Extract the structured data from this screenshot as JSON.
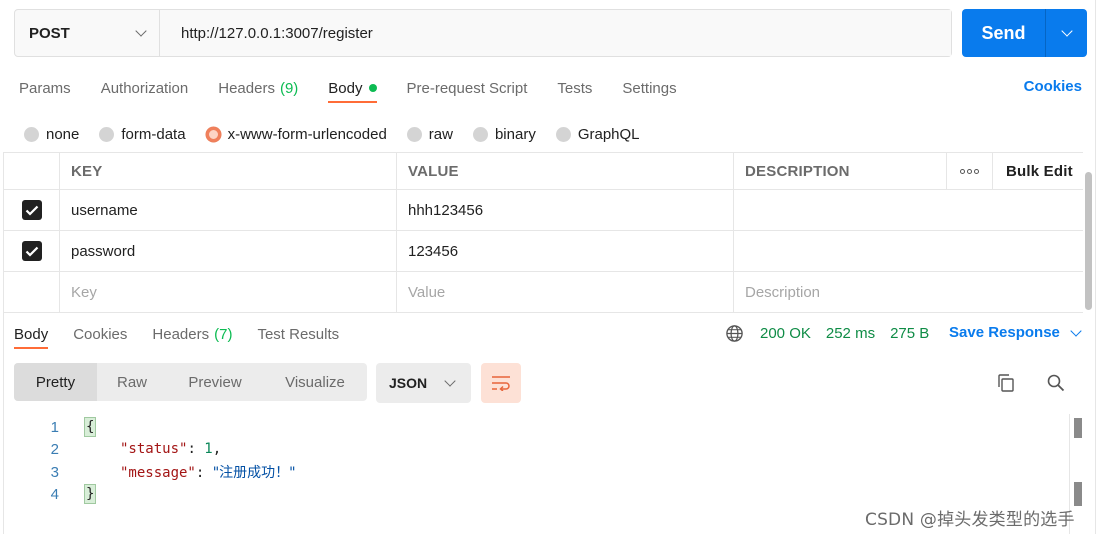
{
  "request": {
    "method": "POST",
    "url": "http://127.0.0.1:3007/register",
    "send_label": "Send"
  },
  "request_tabs": [
    {
      "label": "Params",
      "count": "",
      "active": false
    },
    {
      "label": "Authorization",
      "count": "",
      "active": false
    },
    {
      "label": "Headers",
      "count": "(9)",
      "active": false
    },
    {
      "label": "Body",
      "count": "",
      "active": true
    },
    {
      "label": "Pre-request Script",
      "count": "",
      "active": false
    },
    {
      "label": "Tests",
      "count": "",
      "active": false
    },
    {
      "label": "Settings",
      "count": "",
      "active": false
    }
  ],
  "cookies_label": "Cookies",
  "body_types": [
    {
      "label": "none",
      "selected": false
    },
    {
      "label": "form-data",
      "selected": false
    },
    {
      "label": "x-www-form-urlencoded",
      "selected": true
    },
    {
      "label": "raw",
      "selected": false
    },
    {
      "label": "binary",
      "selected": false
    },
    {
      "label": "GraphQL",
      "selected": false
    }
  ],
  "params_table": {
    "headers": {
      "key": "KEY",
      "value": "VALUE",
      "description": "DESCRIPTION",
      "bulk_edit": "Bulk Edit"
    },
    "rows": [
      {
        "checked": true,
        "key": "username",
        "value": "hhh123456",
        "description": ""
      },
      {
        "checked": true,
        "key": "password",
        "value": "123456",
        "description": ""
      }
    ],
    "placeholder": {
      "key": "Key",
      "value": "Value",
      "description": "Description"
    }
  },
  "response_tabs": [
    {
      "label": "Body",
      "count": "",
      "active": true
    },
    {
      "label": "Cookies",
      "count": "",
      "active": false
    },
    {
      "label": "Headers",
      "count": "(7)",
      "active": false
    },
    {
      "label": "Test Results",
      "count": "",
      "active": false
    }
  ],
  "response_meta": {
    "status": "200 OK",
    "time": "252 ms",
    "size": "275 B",
    "save_label": "Save Response"
  },
  "view_modes": [
    {
      "label": "Pretty",
      "active": true
    },
    {
      "label": "Raw",
      "active": false
    },
    {
      "label": "Preview",
      "active": false
    },
    {
      "label": "Visualize",
      "active": false
    }
  ],
  "format": "JSON",
  "code_lines": {
    "n1": "1",
    "n2": "2",
    "n3": "3",
    "n4": "4",
    "open": "{",
    "close": "}",
    "status_key": "\"status\"",
    "status_val": "1",
    "message_key": "\"message\"",
    "message_val": "\"注册成功！\""
  },
  "watermark": "CSDN @掉头发类型的选手",
  "colors": {
    "accent": "#ff6c37",
    "send_blue": "#097bed",
    "success_green": "#0f8c46"
  }
}
